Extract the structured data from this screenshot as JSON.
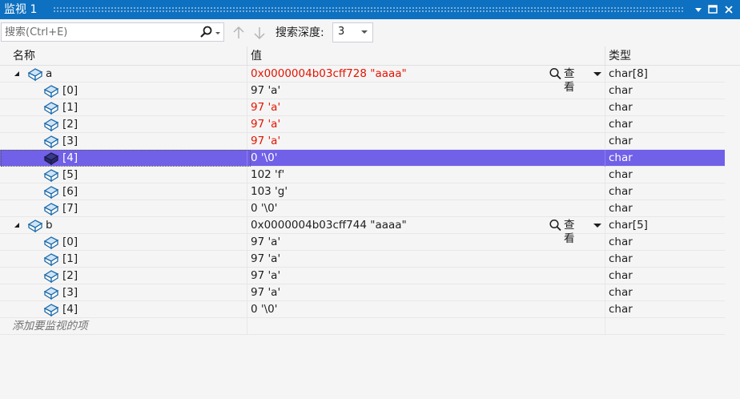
{
  "window": {
    "title": "监视 1"
  },
  "toolbar": {
    "search_placeholder": "搜索(Ctrl+E)",
    "depth_label": "搜索深度:",
    "depth_value": "3"
  },
  "columns": {
    "name": "名称",
    "value": "值",
    "type": "类型"
  },
  "view_label": "查看",
  "rows": [
    {
      "level": 0,
      "expanded": true,
      "name": "a",
      "value": "0x0000004b03cff728 \"aaaa\"",
      "type": "char[8]",
      "value_changed": true,
      "has_view": true,
      "selected": false
    },
    {
      "level": 1,
      "name": "[0]",
      "value": "97 'a'",
      "type": "char",
      "value_changed": false,
      "selected": false
    },
    {
      "level": 1,
      "name": "[1]",
      "value": "97 'a'",
      "type": "char",
      "value_changed": true,
      "selected": false
    },
    {
      "level": 1,
      "name": "[2]",
      "value": "97 'a'",
      "type": "char",
      "value_changed": true,
      "selected": false
    },
    {
      "level": 1,
      "name": "[3]",
      "value": "97 'a'",
      "type": "char",
      "value_changed": true,
      "selected": false
    },
    {
      "level": 1,
      "name": "[4]",
      "value": "0 '\\0'",
      "type": "char",
      "value_changed": false,
      "selected": true
    },
    {
      "level": 1,
      "name": "[5]",
      "value": "102 'f'",
      "type": "char",
      "value_changed": false,
      "selected": false
    },
    {
      "level": 1,
      "name": "[6]",
      "value": "103 'g'",
      "type": "char",
      "value_changed": false,
      "selected": false
    },
    {
      "level": 1,
      "name": "[7]",
      "value": "0 '\\0'",
      "type": "char",
      "value_changed": false,
      "selected": false
    },
    {
      "level": 0,
      "expanded": true,
      "name": "b",
      "value": "0x0000004b03cff744 \"aaaa\"",
      "type": "char[5]",
      "value_changed": false,
      "has_view": true,
      "selected": false
    },
    {
      "level": 1,
      "name": "[0]",
      "value": "97 'a'",
      "type": "char",
      "value_changed": false,
      "selected": false
    },
    {
      "level": 1,
      "name": "[1]",
      "value": "97 'a'",
      "type": "char",
      "value_changed": false,
      "selected": false
    },
    {
      "level": 1,
      "name": "[2]",
      "value": "97 'a'",
      "type": "char",
      "value_changed": false,
      "selected": false
    },
    {
      "level": 1,
      "name": "[3]",
      "value": "97 'a'",
      "type": "char",
      "value_changed": false,
      "selected": false
    },
    {
      "level": 1,
      "name": "[4]",
      "value": "0 '\\0'",
      "type": "char",
      "value_changed": false,
      "selected": false
    }
  ],
  "add_item_text": "添加要监视的项",
  "colors": {
    "titlebar": "#0e70c0",
    "selection": "#7160e8",
    "changed_value": "#e51400",
    "background": "#f5f5f5"
  },
  "icons": {
    "search": "search-icon",
    "nav_up": "arrow-up-icon",
    "nav_down": "arrow-down-icon",
    "variable": "variable-object-icon",
    "view": "magnifier-icon"
  }
}
